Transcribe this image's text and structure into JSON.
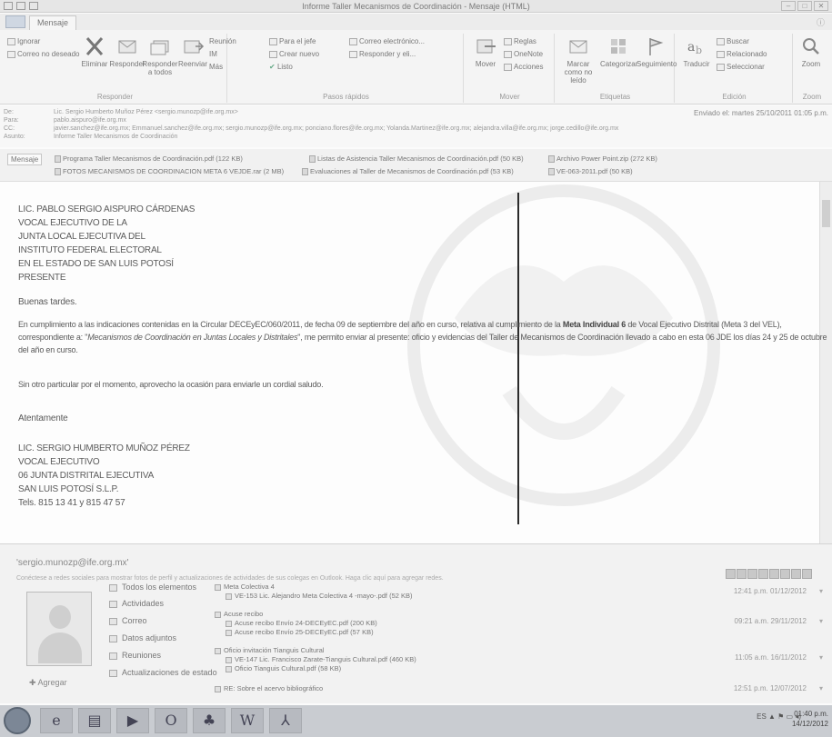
{
  "window": {
    "title": "Informe Taller Mecanismos de Coordinación - Mensaje (HTML)"
  },
  "ribbon": {
    "tab_label": "Mensaje",
    "help": "ⓘ",
    "groups": {
      "responder": {
        "ignore": "Ignorar",
        "junk": "Correo no deseado",
        "delete": "Eliminar",
        "reply": "Responder",
        "reply_all": "Responder a todos",
        "forward": "Reenviar",
        "meeting": "Reunión",
        "im": "IM",
        "more": "Más",
        "label": "Responder"
      },
      "pasos": {
        "manager": "Para el jefe",
        "team": "Correo electrónico...",
        "done": "Listo",
        "create": "Crear nuevo",
        "reply_delete": "Responder y eli...",
        "label": "Pasos rápidos"
      },
      "mover": {
        "move": "Mover",
        "rules": "Reglas",
        "onenote": "OneNote",
        "actions": "Acciones",
        "label": "Mover"
      },
      "etiquetas": {
        "unread": "Marcar como no leído",
        "categorize": "Categorizar",
        "followup": "Seguimiento",
        "label": "Etiquetas"
      },
      "edicion": {
        "translate": "Traducir",
        "find": "Buscar",
        "related": "Relacionado",
        "select": "Seleccionar",
        "label": "Edición"
      },
      "zoom": {
        "zoom": "Zoom",
        "label": "Zoom"
      }
    }
  },
  "header": {
    "from_label": "De:",
    "from": "Lic. Sergio Humberto Muñoz Pérez <sergio.munozp@ife.org.mx>",
    "to_label": "Para:",
    "to": "pablo.aispuro@ife.org.mx",
    "cc_label": "CC:",
    "cc": "javier.sanchez@ife.org.mx;   Emmanuel.sanchez@ife.org.mx;   sergio.munozp@ife.org.mx;   ponciano.flores@ife.org.mx;   Yolanda.Martinez@ife.org.mx;   alejandra.villa@ife.org.mx;   jorge.cedillo@ife.org.mx",
    "subject_label": "Asunto:",
    "subject": "Informe Taller Mecanismos de Coordinación",
    "sent": "Enviado el:  martes 25/10/2011 01:05 p.m."
  },
  "attachments": {
    "message_button": "Mensaje",
    "items": [
      "Programa Taller Mecanismos de Coordinación.pdf (122 KB)",
      "Listas de Asistencia Taller Mecanismos de Coordinación.pdf (50 KB)",
      "Archivo Power Point.zip (272 KB)",
      "FOTOS MECANISMOS DE COORDINACION META 6 VEJDE.rar (2 MB)",
      "Evaluaciones al Taller de Mecanismos de Coordinación.pdf (53 KB)",
      "VE-063-2011.pdf (50 KB)"
    ]
  },
  "body": {
    "recipient": [
      "LIC. PABLO SERGIO AISPURO CÁRDENAS",
      "VOCAL EJECUTIVO DE LA",
      "JUNTA LOCAL EJECUTIVA DEL",
      "INSTITUTO FEDERAL ELECTORAL",
      "EN EL ESTADO DE SAN LUIS POTOSÍ",
      "PRESENTE"
    ],
    "greeting": "Buenas tardes.",
    "para1_a": "En cumplimiento a las indicaciones contenidas en la Circular DECEyEC/060/2011, de fecha 09 de septiembre del año en curso, relativa al cumplimiento de la ",
    "para1_b": "Meta Individual 6",
    "para1_c": " de Vocal Ejecutivo Distrital (Meta 3 del VEL), correspondiente a: \"",
    "para1_d": "Mecanismos de Coordinación en Juntas Locales y Distritales",
    "para1_e": "\", me permito enviar al presente: oficio y evidencias del Taller de Mecanismos de Coordinación llevado a cabo en esta 06 JDE los días 24 y 25 de octubre del año en curso.",
    "para2": "Sin otro particular por el momento, aprovecho la ocasión para enviarle un cordial saludo.",
    "closing": "Atentamente",
    "signature": [
      "LIC. SERGIO HUMBERTO MUÑOZ PÉREZ",
      "VOCAL EJECUTIVO",
      "06 JUNTA DISTRITAL EJECUTIVA",
      "SAN LUIS POTOSÍ S.L.P.",
      "Tels. 815 13 41 y 815 47 57"
    ]
  },
  "people_pane": {
    "contact": "'sergio.munozp@ife.org.mx'",
    "hint": "Conéctese a redes sociales para mostrar fotos de perfil y actualizaciones de actividades de sus colegas en Outlook. Haga clic aquí para agregar redes.",
    "add": "Agregar",
    "nav": [
      "Todos los elementos",
      "Actividades",
      "Correo",
      "Datos adjuntos",
      "Reuniones",
      "Actualizaciones de estado"
    ],
    "items": [
      {
        "title": "Meta Colectiva 4",
        "sub": "VE-153 Lic. Alejandro Meta Colectiva 4 -mayo-.pdf (52 KB)",
        "date": "12:41 p.m. 01/12/2012"
      },
      {
        "title": "Acuse recibo",
        "sub": "Acuse recibo Envío 24-DECEyEC.pdf (200 KB)",
        "sub2": "Acuse recibo Envío 25-DECEyEC.pdf (57 KB)",
        "date": "09:21 a.m. 29/11/2012"
      },
      {
        "title": "Oficio invitación Tianguis Cultural",
        "sub": "VE-147 Lic. Francisco Zarate-Tianguis Cultural.pdf (460 KB)",
        "sub2": "Oficio Tianguis Cultural.pdf (58 KB)",
        "date": "11:05 a.m. 16/11/2012"
      },
      {
        "title": "RE: Sobre el acervo bibliográfico",
        "date": "12:51 p.m. 12/07/2012"
      }
    ]
  },
  "taskbar": {
    "tray": "ES  ▲ ⚑ ▭ ◂)",
    "time": "01:40 p.m.",
    "date": "14/12/2012"
  }
}
